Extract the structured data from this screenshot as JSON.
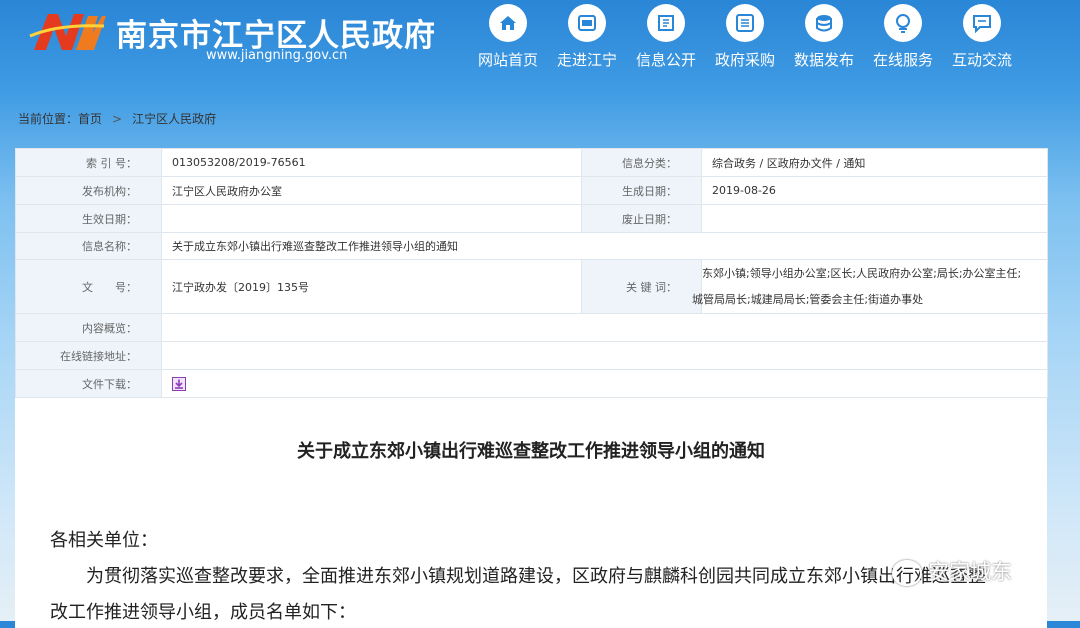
{
  "header": {
    "title": "南京市江宁区人民政府",
    "url": "www.jiangning.gov.cn",
    "logo_text": "NJN"
  },
  "nav": {
    "items": [
      {
        "label": "网站首页",
        "icon": "home-icon"
      },
      {
        "label": "走进江宁",
        "icon": "map-icon"
      },
      {
        "label": "信息公开",
        "icon": "document-icon"
      },
      {
        "label": "政府采购",
        "icon": "list-icon"
      },
      {
        "label": "数据发布",
        "icon": "database-icon"
      },
      {
        "label": "在线服务",
        "icon": "service-icon"
      },
      {
        "label": "互动交流",
        "icon": "chat-icon"
      }
    ]
  },
  "breadcrumb": {
    "prefix": "当前位置：",
    "home": "首页",
    "current": "江宁区人民政府"
  },
  "meta": {
    "index_label": "索 引 号：",
    "index_value": "013053208/2019-76561",
    "category_label": "信息分类：",
    "category_value": "综合政务 / 区政府办文件 / 通知",
    "issuer_label": "发布机构：",
    "issuer_value": "江宁区人民政府办公室",
    "created_label": "生成日期：",
    "created_value": "2019-08-26",
    "effective_label": "生效日期：",
    "effective_value": "",
    "expiry_label": "废止日期：",
    "expiry_value": "",
    "name_label": "信息名称：",
    "name_value": "关于成立东郊小镇出行难巡查整改工作推进领导小组的通知",
    "docno_label": "文　　号：",
    "docno_value": "江宁政办发〔2019〕135号",
    "keywords_label": "关 键 词：",
    "keywords_line1": "东郊小镇;领导小组办公室;区长;人民政府办公室;局长;办公室主任;",
    "keywords_line2": "城管局局长;城建局局长;管委会主任;街道办事处",
    "summary_label": "内容概览：",
    "summary_value": "",
    "link_label": "在线链接地址：",
    "link_value": "",
    "download_label": "文件下载："
  },
  "document": {
    "title": "关于成立东郊小镇出行难巡查整改工作推进领导小组的通知",
    "salutation": "各相关单位：",
    "para1_line1": "为贯彻落实巡查整改要求，全面推进东郊小镇规划道路建设，区政府与麒麟科创园共同成立东郊小镇出行难巡查整",
    "para1_line2": "改工作推进领导小组，成员名单如下："
  },
  "watermark": {
    "text": "安家城东"
  },
  "colors": {
    "header_blue": "#2a86d6",
    "label_bg": "#eef4fa",
    "border": "#dfe6ee",
    "logo_red": "#e63a1e",
    "download_purple": "#8a3fb8"
  }
}
